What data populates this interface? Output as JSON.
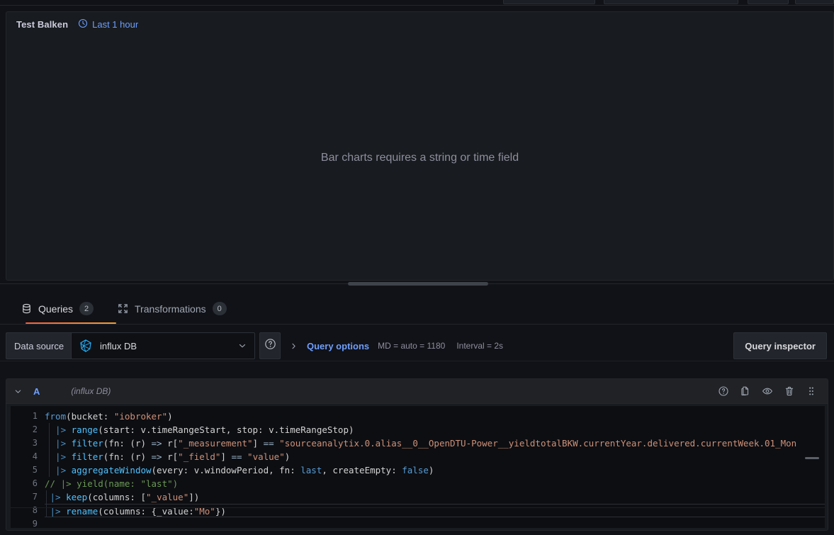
{
  "panel": {
    "title": "Test Balken",
    "time_range": "Last 1 hour",
    "clock_icon": "clock-icon",
    "message": "Bar charts requires a string or time field"
  },
  "tabs": [
    {
      "label": "Queries",
      "badge": "2",
      "icon": "database-icon",
      "active": true
    },
    {
      "label": "Transformations",
      "badge": "0",
      "icon": "process-icon",
      "active": false
    }
  ],
  "datasource_row": {
    "label": "Data source",
    "selected": "influx DB",
    "logo_icon": "influxdb-logo-icon",
    "chevron_icon": "chevron-down-icon",
    "help_icon": "help-circle-icon",
    "query_options": {
      "label": "Query options",
      "expand_icon": "chevron-right-icon",
      "max_data_points": "MD = auto = 1180",
      "interval": "Interval = 2s"
    },
    "query_inspector_label": "Query inspector"
  },
  "query": {
    "ref_id": "A",
    "datasource_hint": "(influx DB)",
    "collapse_icon": "chevron-down-icon",
    "actions": [
      {
        "name": "help-circle-icon",
        "title": "Show data source help"
      },
      {
        "name": "copy-icon",
        "title": "Duplicate query"
      },
      {
        "name": "eye-icon",
        "title": "Disable/enable query"
      },
      {
        "name": "trash-icon",
        "title": "Remove query"
      },
      {
        "name": "drag-handle-icon",
        "title": "Drag to reorder"
      }
    ]
  },
  "editor": {
    "line_numbers": [
      "1",
      "2",
      "3",
      "4",
      "5",
      "6",
      "7",
      "8",
      "9"
    ],
    "lines": [
      {
        "n": 1,
        "segments": [
          {
            "t": "from",
            "c": "fn2"
          },
          {
            "t": "(bucket: ",
            "c": "plain"
          },
          {
            "t": "\"iobroker\"",
            "c": "str"
          },
          {
            "t": ")",
            "c": "plain"
          }
        ]
      },
      {
        "n": 2,
        "segments": [
          {
            "t": "  |> ",
            "c": "pipe"
          },
          {
            "t": "range",
            "c": "fn"
          },
          {
            "t": "(start: v.timeRangeStart, stop: v.timeRangeStop)",
            "c": "plain"
          }
        ]
      },
      {
        "n": 3,
        "segments": [
          {
            "t": "  |> ",
            "c": "pipe"
          },
          {
            "t": "filter",
            "c": "fn"
          },
          {
            "t": "(fn: (r) ",
            "c": "plain"
          },
          {
            "t": "=>",
            "c": "op"
          },
          {
            "t": " r[",
            "c": "plain"
          },
          {
            "t": "\"_measurement\"",
            "c": "str"
          },
          {
            "t": "] ",
            "c": "plain"
          },
          {
            "t": "==",
            "c": "op"
          },
          {
            "t": " \"sourceanalytix.0.alias__0__OpenDTU-Power__yieldtotalBKW.currentYear.delivered.currentWeek.01_Mon",
            "c": "str"
          }
        ]
      },
      {
        "n": 4,
        "segments": [
          {
            "t": "  |> ",
            "c": "pipe"
          },
          {
            "t": "filter",
            "c": "fn"
          },
          {
            "t": "(fn: (r) ",
            "c": "plain"
          },
          {
            "t": "=>",
            "c": "op"
          },
          {
            "t": " r[",
            "c": "plain"
          },
          {
            "t": "\"_field\"",
            "c": "str"
          },
          {
            "t": "] ",
            "c": "plain"
          },
          {
            "t": "==",
            "c": "op"
          },
          {
            "t": " ",
            "c": "plain"
          },
          {
            "t": "\"value\"",
            "c": "str"
          },
          {
            "t": ")",
            "c": "plain"
          }
        ]
      },
      {
        "n": 5,
        "segments": [
          {
            "t": "  |> ",
            "c": "pipe"
          },
          {
            "t": "aggregateWindow",
            "c": "fn"
          },
          {
            "t": "(every: v.windowPeriod, fn: ",
            "c": "plain"
          },
          {
            "t": "last",
            "c": "kw"
          },
          {
            "t": ", createEmpty: ",
            "c": "plain"
          },
          {
            "t": "false",
            "c": "kw"
          },
          {
            "t": ")",
            "c": "plain"
          }
        ]
      },
      {
        "n": 6,
        "segments": [
          {
            "t": "// |> yield(name: \"last\")",
            "c": "comment"
          }
        ]
      },
      {
        "n": 7,
        "segments": [
          {
            "t": " |> ",
            "c": "pipe"
          },
          {
            "t": "keep",
            "c": "fn"
          },
          {
            "t": "(columns: [",
            "c": "plain"
          },
          {
            "t": "\"_value\"",
            "c": "str"
          },
          {
            "t": "])",
            "c": "plain"
          }
        ]
      },
      {
        "n": 8,
        "segments": [
          {
            "t": " |> ",
            "c": "pipe"
          },
          {
            "t": "rename",
            "c": "fn"
          },
          {
            "t": "(columns: {_value:",
            "c": "plain"
          },
          {
            "t": "\"Mo\"",
            "c": "str"
          },
          {
            "t": "})",
            "c": "plain"
          }
        ]
      },
      {
        "n": 9,
        "segments": []
      }
    ],
    "active_line": 8
  },
  "colors": {
    "accent_orange": "#f55f3e",
    "link_blue": "#6e9fff",
    "panel_bg": "#181b1f",
    "app_bg": "#111217",
    "editor_bg": "#0d0e12"
  }
}
